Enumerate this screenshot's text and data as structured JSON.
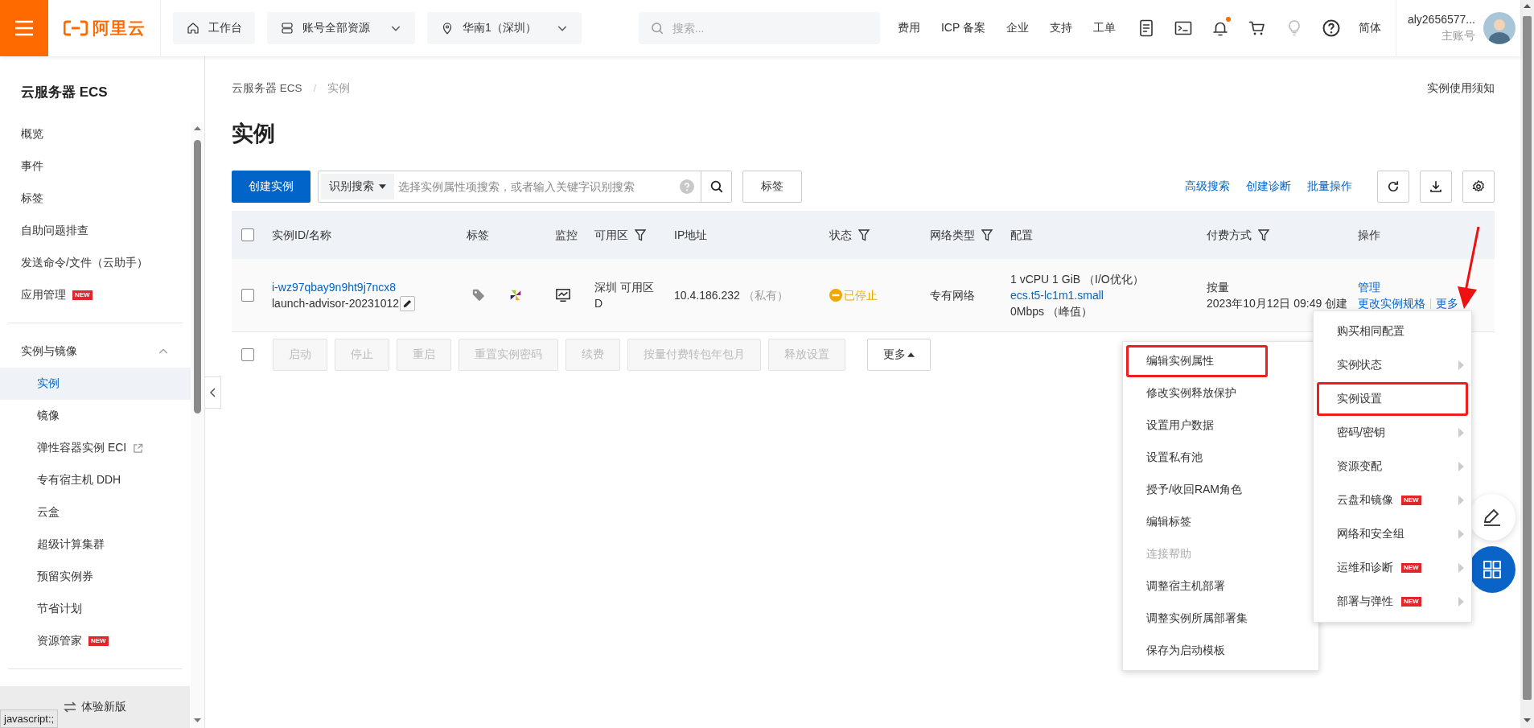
{
  "top_bar": {
    "logo": "阿里云",
    "nav": [
      {
        "kind": "home",
        "label": "工作台",
        "dropdown": false
      },
      {
        "kind": "stack",
        "label": "账号全部资源",
        "dropdown": true
      },
      {
        "kind": "pin",
        "label": "华南1（深圳）",
        "dropdown": true
      }
    ],
    "search": {
      "placeholder": "搜索..."
    },
    "links": [
      "费用",
      "ICP 备案",
      "企业",
      "支持",
      "工单"
    ],
    "icons": [
      {
        "kind": "app",
        "unread": false
      },
      {
        "kind": "terminal",
        "unread": false
      },
      {
        "kind": "bell",
        "unread": true
      },
      {
        "kind": "cart",
        "unread": false
      },
      {
        "kind": "bulb",
        "unread": false
      },
      {
        "kind": "help",
        "unread": false
      }
    ],
    "language": "简体",
    "account": {
      "name": "aly2656577...",
      "role": "主账号"
    }
  },
  "sidebar": {
    "title": "云服务器 ECS",
    "sections": [
      {
        "items": [
          {
            "label": "概览",
            "kind": "link",
            "selected": false
          },
          {
            "label": "事件",
            "kind": "link",
            "selected": false
          },
          {
            "label": "标签",
            "kind": "link",
            "selected": false
          },
          {
            "label": "自助问题排查",
            "kind": "link",
            "selected": false
          },
          {
            "label": "发送命令/文件（云助手）",
            "kind": "link",
            "selected": false
          },
          {
            "label": "应用管理",
            "kind": "link",
            "selected": false,
            "badge": "NEW"
          }
        ]
      },
      {
        "heading": "实例与镜像",
        "expanded": true,
        "items": [
          {
            "label": "实例",
            "kind": "link",
            "selected": true
          },
          {
            "label": "镜像",
            "kind": "link",
            "selected": false
          },
          {
            "label": "弹性容器实例 ECI",
            "kind": "external",
            "selected": false
          },
          {
            "label": "专有宿主机 DDH",
            "kind": "link",
            "selected": false
          },
          {
            "label": "云盒",
            "kind": "link",
            "selected": false
          },
          {
            "label": "超级计算集群",
            "kind": "link",
            "selected": false
          },
          {
            "label": "预留实例券",
            "kind": "link",
            "selected": false
          },
          {
            "label": "节省计划",
            "kind": "link",
            "selected": false
          },
          {
            "label": "资源管家",
            "kind": "link",
            "selected": false,
            "badge": "NEW"
          }
        ]
      }
    ],
    "footer": "体验新版"
  },
  "main": {
    "breadcrumb": [
      "云服务器 ECS",
      "实例"
    ],
    "breadcrumb_separator": "/",
    "notice_link": "实例使用须知",
    "title": "实例",
    "toolbar": {
      "create_button": "创建实例",
      "search_mode": "识别搜索",
      "search_placeholder": "选择实例属性项搜索，或者输入关键字识别搜索",
      "tag_button": "标签",
      "links": [
        "高级搜索",
        "创建诊断",
        "批量操作"
      ],
      "icon_buttons": [
        {
          "kind": "refresh"
        },
        {
          "kind": "download"
        },
        {
          "kind": "settings"
        }
      ]
    },
    "table": {
      "header_checked": false,
      "columns": [
        {
          "label": "实例ID/名称",
          "filter": false
        },
        {
          "label": "标签",
          "filter": false
        },
        {
          "label": "监控",
          "filter": false
        },
        {
          "label": "可用区",
          "filter": true
        },
        {
          "label": "IP地址",
          "filter": false
        },
        {
          "label": "状态",
          "filter": true
        },
        {
          "label": "网络类型",
          "filter": true
        },
        {
          "label": "配置",
          "filter": false
        },
        {
          "label": "付费方式",
          "filter": true
        },
        {
          "label": "操作",
          "filter": false
        }
      ],
      "rows": [
        {
          "checked": false,
          "id": "i-wz97qbay9n9ht9j7ncx8",
          "name": "launch-advisor-20231012",
          "zone": "深圳 可用区D",
          "ip": "10.4.186.232",
          "ip_type": "（私有）",
          "status": {
            "label": "已停止",
            "kind": "stopped"
          },
          "network": "专有网络",
          "config": {
            "spec": "1 vCPU 1 GiB （I/O优化）",
            "type": "ecs.t5-lc1m1.small",
            "bandwidth": "0Mbps （峰值）"
          },
          "billing": "按量",
          "created": "2023年10月12日 09:49 创建",
          "actions": [
            "管理",
            "更改实例规格",
            "更多"
          ]
        }
      ]
    },
    "batch_actions": {
      "checked": false,
      "buttons": [
        {
          "label": "启动",
          "disabled": true,
          "kind": "plain"
        },
        {
          "label": "停止",
          "disabled": true,
          "kind": "plain"
        },
        {
          "label": "重启",
          "disabled": true,
          "kind": "plain"
        },
        {
          "label": "重置实例密码",
          "disabled": true,
          "kind": "plain"
        },
        {
          "label": "续费",
          "disabled": true,
          "kind": "plain"
        },
        {
          "label": "按量付费转包年包月",
          "disabled": true,
          "kind": "plain"
        },
        {
          "label": "释放设置",
          "disabled": true,
          "kind": "plain"
        },
        {
          "label": "更多",
          "disabled": false,
          "kind": "menu"
        }
      ]
    }
  },
  "more_menu": [
    {
      "label": "购买相同配置",
      "submenu": false,
      "highlighted": false
    },
    {
      "label": "实例状态",
      "submenu": true,
      "highlighted": false
    },
    {
      "label": "实例设置",
      "submenu": false,
      "highlighted": true
    },
    {
      "label": "密码/密钥",
      "submenu": true,
      "highlighted": false
    },
    {
      "label": "资源变配",
      "submenu": true,
      "highlighted": false
    },
    {
      "label": "云盘和镜像",
      "submenu": true,
      "highlighted": false,
      "badge": "NEW"
    },
    {
      "label": "网络和安全组",
      "submenu": true,
      "highlighted": false
    },
    {
      "label": "运维和诊断",
      "submenu": true,
      "highlighted": false,
      "badge": "NEW"
    },
    {
      "label": "部署与弹性",
      "submenu": true,
      "highlighted": false,
      "badge": "NEW"
    }
  ],
  "settings_submenu": [
    {
      "label": "编辑实例属性",
      "highlighted": true,
      "disabled": false
    },
    {
      "label": "修改实例释放保护",
      "highlighted": false,
      "disabled": false
    },
    {
      "label": "设置用户数据",
      "highlighted": false,
      "disabled": false
    },
    {
      "label": "设置私有池",
      "highlighted": false,
      "disabled": false
    },
    {
      "label": "授予/收回RAM角色",
      "highlighted": false,
      "disabled": false
    },
    {
      "label": "编辑标签",
      "highlighted": false,
      "disabled": false
    },
    {
      "label": "连接帮助",
      "highlighted": false,
      "disabled": true
    },
    {
      "label": "调整宿主机部署",
      "highlighted": false,
      "disabled": false
    },
    {
      "label": "调整实例所属部署集",
      "highlighted": false,
      "disabled": false
    },
    {
      "label": "保存为启动模板",
      "highlighted": false,
      "disabled": false
    }
  ],
  "status_tooltip": "javascript:;"
}
